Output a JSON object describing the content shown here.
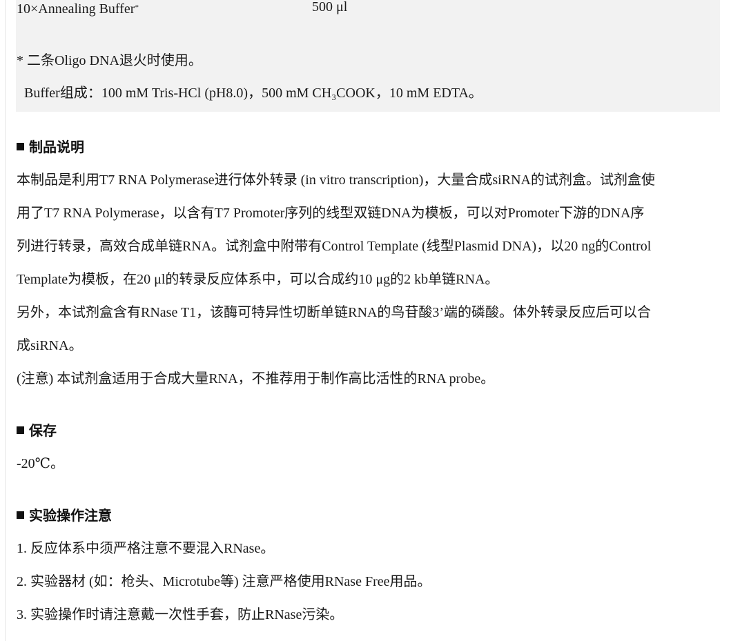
{
  "reagent": {
    "name": "10×Annealing Buffer",
    "name_mark": "*",
    "volume": "500 μl"
  },
  "footnote": "* 二条Oligo DNA退火时使用。",
  "buffer_composition": "Buffer组成：100 mM Tris-HCl (pH8.0)，500 mM CH₃COOK，10 mM EDTA。",
  "sections": {
    "description": {
      "title": "制品说明",
      "lines": [
        "本制品是利用T7 RNA Polymerase进行体外转录 (in vitro transcription)，大量合成siRNA的试剂盒。试剂盒使",
        "用了T7 RNA Polymerase，以含有T7 Promoter序列的线型双链DNA为模板，可以对Promoter下游的DNA序",
        "列进行转录，高效合成单链RNA。试剂盒中附带有Control Template (线型Plasmid DNA)，以20 ng的Control",
        "Template为模板，在20 μl的转录反应体系中，可以合成约10 μg的2 kb单链RNA。",
        "另外，本试剂盒含有RNase T1，该酶可特异性切断单链RNA的鸟苷酸3’端的磷酸。体外转录反应后可以合",
        "成siRNA。",
        "(注意) 本试剂盒适用于合成大量RNA，不推荐用于制作高比活性的RNA probe。"
      ]
    },
    "storage": {
      "title": "保存",
      "lines": [
        "-20℃。"
      ]
    },
    "precautions": {
      "title": "实验操作注意",
      "lines": [
        "1. 反应体系中须严格注意不要混入RNase。",
        "2. 实验器材 (如：枪头、Microtube等) 注意严格使用RNase Free用品。",
        "3. 实验操作时请注意戴一次性手套，防止RNase污染。"
      ]
    }
  }
}
